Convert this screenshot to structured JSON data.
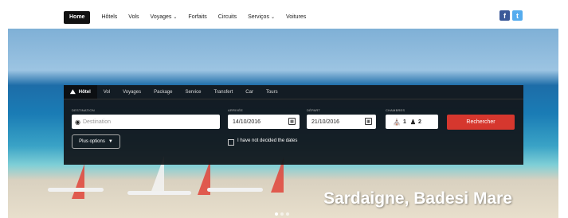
{
  "nav": {
    "items": [
      {
        "label": "Home",
        "active": true,
        "dropdown": false
      },
      {
        "label": "Hôtels",
        "active": false,
        "dropdown": false
      },
      {
        "label": "Vols",
        "active": false,
        "dropdown": false
      },
      {
        "label": "Voyages",
        "active": false,
        "dropdown": true
      },
      {
        "label": "Forfaits",
        "active": false,
        "dropdown": false
      },
      {
        "label": "Circuits",
        "active": false,
        "dropdown": false
      },
      {
        "label": "Serviços",
        "active": false,
        "dropdown": true
      },
      {
        "label": "Voitures",
        "active": false,
        "dropdown": false
      }
    ],
    "social": {
      "facebook": "f",
      "twitter": "t"
    }
  },
  "search": {
    "tabs": [
      {
        "label": "Hôtel",
        "active": true,
        "icon": "hotel-icon"
      },
      {
        "label": "Vol",
        "active": false
      },
      {
        "label": "Voyages",
        "active": false
      },
      {
        "label": "Package",
        "active": false
      },
      {
        "label": "Service",
        "active": false
      },
      {
        "label": "Transfert",
        "active": false
      },
      {
        "label": "Car",
        "active": false
      },
      {
        "label": "Tours",
        "active": false
      }
    ],
    "destination_label": "DESTINATION",
    "destination_placeholder": "Destination",
    "arrival_label": "ARRIVÉE",
    "arrival_value": "14/10/2016",
    "departure_label": "DÉPART",
    "departure_value": "21/10/2016",
    "rooms_label": "CHAMBRES",
    "rooms_value": "1",
    "guests_value": "2",
    "search_button": "Rechercher",
    "more_options": "Plus options",
    "no_dates_label": "I have not decided the dates"
  },
  "hero": {
    "caption": "Sardaigne, Badesi Mare"
  },
  "colors": {
    "accent": "#d6372e",
    "panel": "#12161a",
    "facebook": "#3b5998",
    "twitter": "#55acee"
  }
}
